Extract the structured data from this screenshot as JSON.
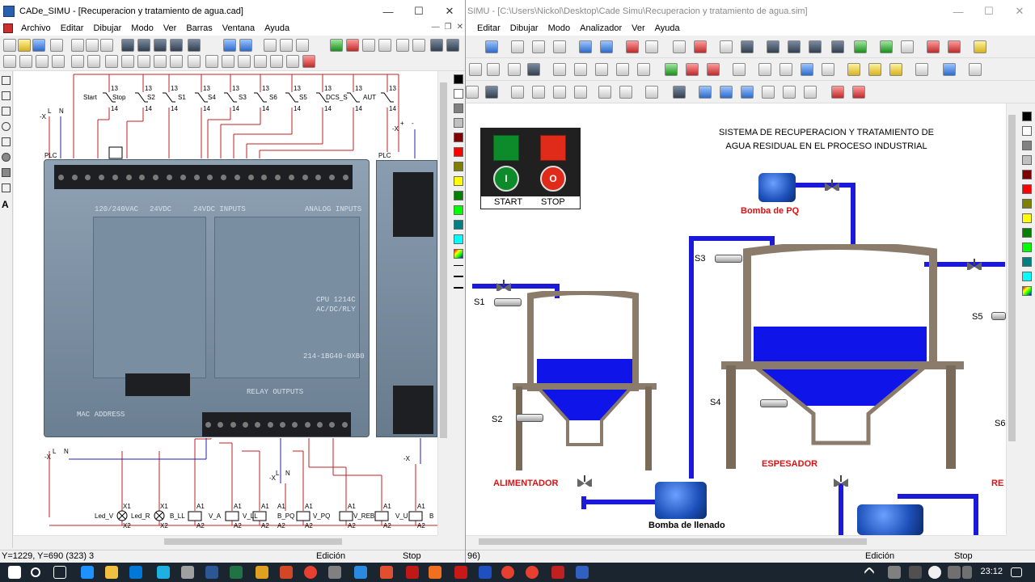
{
  "left_window": {
    "title": "CADe_SIMU - [Recuperacion y tratamiento de agua.cad]",
    "menu": [
      "Archivo",
      "Editar",
      "Dibujar",
      "Modo",
      "Ver",
      "Barras",
      "Ventana",
      "Ayuda"
    ],
    "contacts": [
      "Start",
      "Stop",
      "S2",
      "S1",
      "S4",
      "S3",
      "S6",
      "S5",
      "DCS_S",
      "AUT"
    ],
    "contact_pin_top": "13",
    "contact_pin_bottom": "14",
    "plc_label": "PLC",
    "supply_left": [
      "-X",
      "L",
      "N"
    ],
    "supply_right": [
      "-X",
      "+",
      "-"
    ],
    "plc_printed_text": [
      "120/240VAC",
      "24VDC",
      "24VDC INPUTS",
      "ANALOG INPUTS",
      "CPU 1214C",
      "AC/DC/RLY",
      "RELAY OUTPUTS",
      "214-1BG40-0XB0",
      "MAC ADDRESS"
    ],
    "bottom_supply": [
      "-X",
      "L",
      "N"
    ],
    "outputs": [
      {
        "top": "X1",
        "name": "Led_V",
        "bottom": "X2"
      },
      {
        "top": "X1",
        "name": "Led_R",
        "bottom": "X2"
      },
      {
        "top": "A1",
        "name": "B_LL",
        "bottom": "A2"
      },
      {
        "top": "A1",
        "name": "V_A",
        "bottom": "A2"
      },
      {
        "top": "A1",
        "name": "V_LL",
        "bottom": "A2"
      },
      {
        "top": "A1",
        "name": "B_PQ",
        "bottom": "A2"
      },
      {
        "top": "A1",
        "name": "V_PQ",
        "bottom": "A2"
      },
      {
        "top": "A1",
        "name": "V_REB",
        "bottom": "A2"
      },
      {
        "top": "A1",
        "name": "V_U",
        "bottom": "A2"
      },
      {
        "top": "A1",
        "name": "B",
        "bottom": "A2"
      }
    ],
    "status_coords": "Y=1229, Y=690 (323) 3",
    "status_mode": "Edición",
    "status_state": "Stop"
  },
  "right_window": {
    "title": "SIMU - [C:\\Users\\Nickol\\Desktop\\Cade Simu\\Recuperacion y tratamiento de agua.sim]",
    "menu": [
      "Editar",
      "Dibujar",
      "Modo",
      "Analizador",
      "Ver",
      "Ayuda"
    ],
    "panel": {
      "start_label": "START",
      "stop_label": "STOP",
      "start_symbol": "I",
      "stop_symbol": "O"
    },
    "system_title_line1": "SISTEMA DE RECUPERACION Y TRATAMIENTO DE",
    "system_title_line2": "AGUA RESIDUAL EN EL PROCESO INDUSTRIAL",
    "bomba_pq": "Bomba de PQ",
    "bomba_llenado": "Bomba de llenado",
    "alimentador": "ALIMENTADOR",
    "espesador": "ESPESADOR",
    "reb_partial": "RE",
    "sensors": [
      "S1",
      "S2",
      "S3",
      "S4",
      "S5",
      "S6"
    ],
    "status_coords": "96)",
    "status_mode": "Edición",
    "status_state": "Stop"
  },
  "taskbar": {
    "time": "23:12"
  },
  "colors": {
    "pipe_blue": "#1a1ad8",
    "water_blue": "#0f14e8",
    "start_green": "#0d8a2a",
    "stop_red": "#e02a1a",
    "wire_red": "#c22020",
    "wire_blue": "#2020b0",
    "label_red": "#e01010"
  },
  "palette": [
    "#000000",
    "#ffffff",
    "#808080",
    "#c0c0c0",
    "#800000",
    "#ff0000",
    "#808000",
    "#ffff00",
    "#008000",
    "#00ff00",
    "#008080",
    "#00ffff"
  ],
  "icons": [
    "new-icon",
    "open-icon",
    "save-icon",
    "print-icon",
    "cut-icon",
    "copy-icon",
    "paste-icon",
    "zoom-in-icon",
    "zoom-out-icon",
    "undo-icon",
    "redo-icon",
    "play-icon",
    "stop-icon",
    "pause-icon",
    "help-icon",
    "search-icon",
    "windows-start-icon"
  ]
}
